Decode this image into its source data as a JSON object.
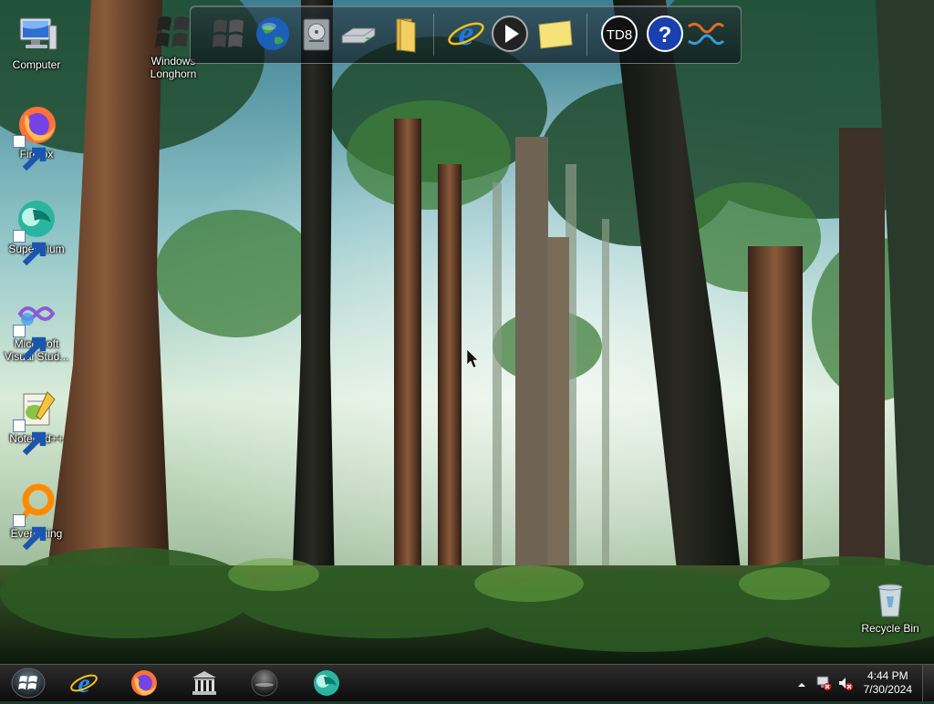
{
  "desktop": {
    "icons": [
      {
        "label": "Computer",
        "icon": "computer-icon"
      },
      {
        "label": "Firefox",
        "icon": "firefox-icon"
      },
      {
        "label": "Supermium",
        "icon": "supermium-icon"
      },
      {
        "label": "Microsoft Visual Stud...",
        "icon": "visual-studio-icon"
      },
      {
        "label": "Notepad++",
        "icon": "notepadpp-icon"
      },
      {
        "label": "Everything",
        "icon": "everything-icon"
      },
      {
        "label": "Windows Longhorn",
        "icon": "windows-longhorn-icon"
      },
      {
        "label": "Recycle Bin",
        "icon": "recycle-bin-icon"
      }
    ]
  },
  "dock": {
    "items": [
      "windows-logo-icon",
      "globe-icon",
      "media-drive-icon",
      "hard-drive-icon",
      "folder-icon",
      "internet-explorer-icon",
      "media-player-icon",
      "sticky-note-icon",
      "td8-icon",
      "help-icon",
      "network-icon"
    ],
    "td8_label": "TD8",
    "help_glyph": "?"
  },
  "taskbar": {
    "pinned": [
      "internet-explorer-icon",
      "firefox-icon",
      "library-icon",
      "media-sphere-icon",
      "supermium-icon"
    ],
    "tray": {
      "time": "4:44 PM",
      "date": "7/30/2024"
    }
  },
  "colors": {
    "taskbar": "#111111",
    "firefox": "#ff7139",
    "ie_blue": "#1e78d7",
    "supermium": "#2bb5a0"
  }
}
